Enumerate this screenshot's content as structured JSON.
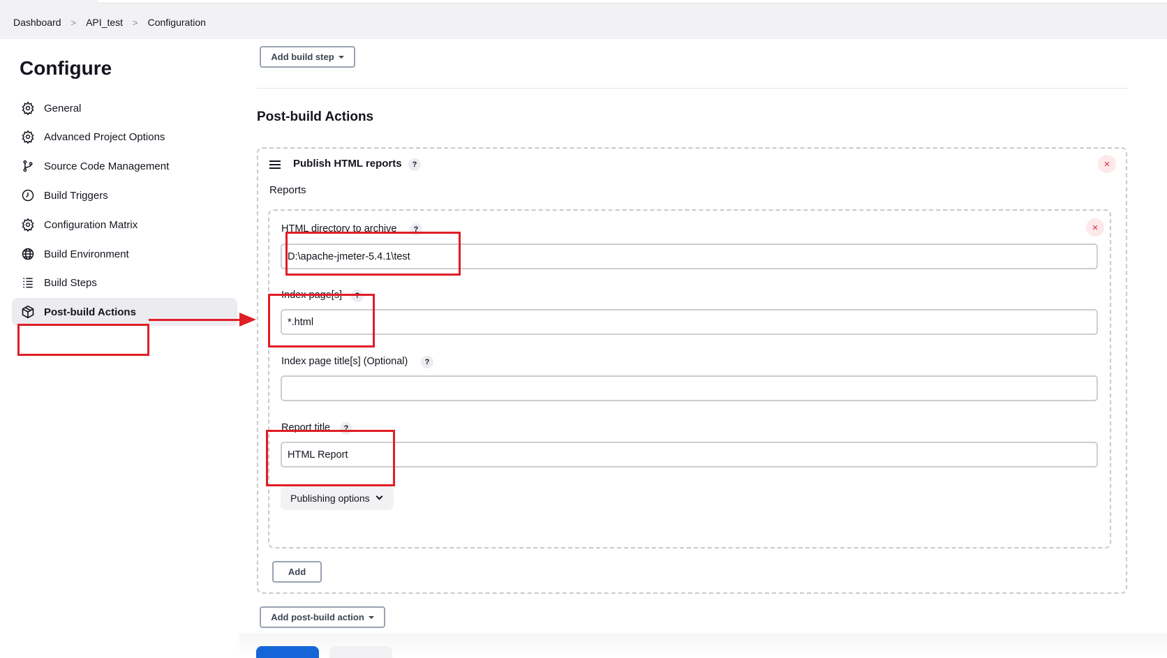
{
  "breadcrumb": [
    "Dashboard",
    "API_test",
    "Configuration"
  ],
  "sidebar": {
    "title": "Configure",
    "items": [
      {
        "label": "General",
        "icon": "gear-icon"
      },
      {
        "label": "Advanced Project Options",
        "icon": "gear-icon"
      },
      {
        "label": "Source Code Management",
        "icon": "git-branch-icon"
      },
      {
        "label": "Build Triggers",
        "icon": "clock-icon"
      },
      {
        "label": "Configuration Matrix",
        "icon": "gear-icon"
      },
      {
        "label": "Build Environment",
        "icon": "globe-icon"
      },
      {
        "label": "Build Steps",
        "icon": "list-icon"
      },
      {
        "label": "Post-build Actions",
        "icon": "package-icon",
        "active": true
      }
    ]
  },
  "main": {
    "add_build_step": "Add build step",
    "section_title": "Post-build Actions",
    "publisher": {
      "title": "Publish HTML reports",
      "reports_label": "Reports",
      "fields": {
        "html_dir": {
          "label": "HTML directory to archive",
          "value": "D:\\apache-jmeter-5.4.1\\test"
        },
        "index_pages": {
          "label": "Index page[s]",
          "value": "*.html"
        },
        "index_titles": {
          "label": "Index page title[s] (Optional)",
          "value": ""
        },
        "report_title": {
          "label": "Report title",
          "value": "HTML Report"
        }
      },
      "publishing_options": "Publishing options",
      "add_label": "Add",
      "help_glyph": "?",
      "close_glyph": "×"
    },
    "add_post_build_action": "Add post-build action"
  },
  "colors": {
    "annotation_red": "#e01e26",
    "primary_blue": "#1565d8",
    "close_red": "#d9303e"
  }
}
